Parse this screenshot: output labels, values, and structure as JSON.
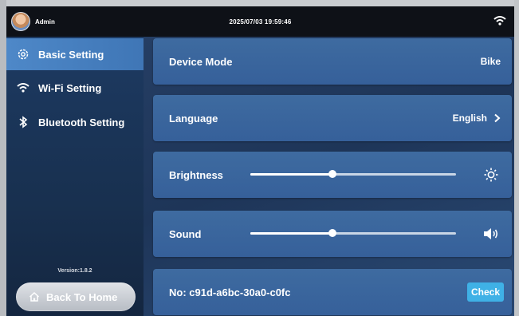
{
  "status_bar": {
    "user_name": "Admin",
    "datetime": "2025/07/03 19:59:46",
    "wifi_icon": "wifi-icon"
  },
  "sidebar": {
    "items": [
      {
        "label": "Basic Setting",
        "icon": "gear-icon",
        "active": true
      },
      {
        "label": "Wi-Fi Setting",
        "icon": "wifi-icon",
        "active": false
      },
      {
        "label": "Bluetooth Setting",
        "icon": "bluetooth-icon",
        "active": false
      }
    ],
    "version": "Version:1.8.2",
    "home_button": {
      "label": "Back To Home",
      "icon": "home-icon"
    }
  },
  "settings": {
    "device_mode": {
      "label": "Device Mode",
      "value": "Bike"
    },
    "language": {
      "label": "Language",
      "value": "English"
    },
    "brightness": {
      "label": "Brightness",
      "level": 0.4,
      "icon": "sun-icon"
    },
    "sound": {
      "label": "Sound",
      "level": 0.4,
      "icon": "speaker-icon"
    },
    "serial": {
      "label": "No:",
      "value": "c91d-a6bc-30a0-c0fc",
      "button": "Check"
    }
  },
  "colors": {
    "active_nav": "#4e88c8",
    "card": "#3e6ba0",
    "check_button": "#3fb1e6"
  }
}
